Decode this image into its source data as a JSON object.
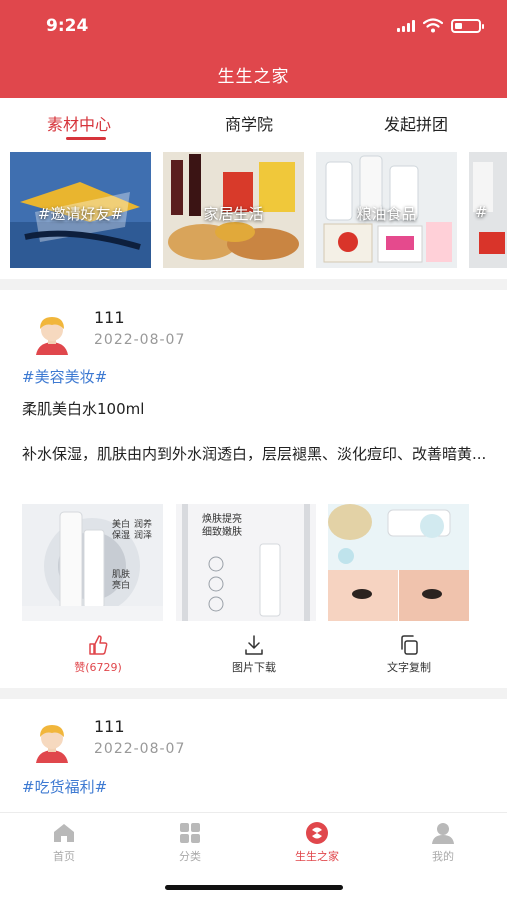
{
  "status_bar": {
    "time": "9:24",
    "battery_level": 0.3
  },
  "header": {
    "title": "生生之家"
  },
  "tabs": [
    {
      "label": "素材中心",
      "active": true
    },
    {
      "label": "商学院",
      "active": false
    },
    {
      "label": "发起拼团",
      "active": false
    }
  ],
  "banners": [
    {
      "label": "#邀请好友#"
    },
    {
      "label": "家居生活"
    },
    {
      "label": "粮油食品"
    },
    {
      "label": "#"
    }
  ],
  "posts": [
    {
      "username": "111",
      "date": "2022-08-07",
      "tag": "#美容美妆#",
      "title": "柔肌美白水100ml",
      "description": "补水保湿，肌肤由内到外水润透白，层层褪黑、淡化痘印、改善暗黄...",
      "images": [
        {
          "lines": [
            "美白保湿",
            "肌肤亮白"
          ],
          "sublines": [
            "润养润泽"
          ]
        },
        {
          "lines": [
            "焕肤提亮",
            "细致嫩肤"
          ],
          "sublines": []
        },
        {
          "lines": [],
          "sublines": []
        }
      ],
      "actions": {
        "like": "赞(6729)",
        "download": "图片下载",
        "copy": "文字复制"
      }
    },
    {
      "username": "111",
      "date": "2022-08-07",
      "tag": "#吃货福利#"
    }
  ],
  "bottom_nav": [
    {
      "label": "首页",
      "icon": "home-icon",
      "active": false
    },
    {
      "label": "分类",
      "icon": "category-icon",
      "active": false
    },
    {
      "label": "生生之家",
      "icon": "brand-icon",
      "active": true
    },
    {
      "label": "我的",
      "icon": "profile-icon",
      "active": false
    }
  ],
  "colors": {
    "brand": "#e0474c",
    "tag": "#3e7ad2",
    "muted": "#999999"
  }
}
